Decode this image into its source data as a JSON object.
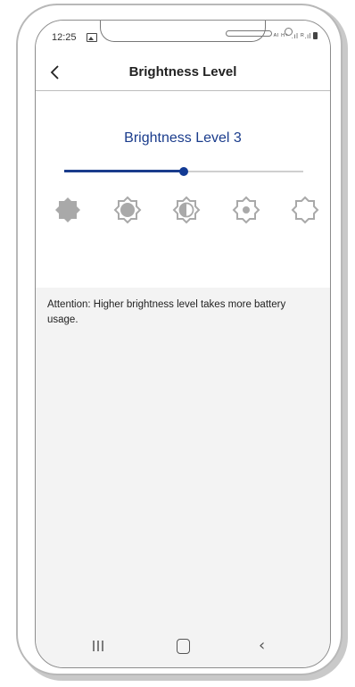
{
  "status_bar": {
    "time": "12:25",
    "indicators": "ᴬᴵ ᴴ⁺ .ıl ᴿ.ıl"
  },
  "header": {
    "back_icon": "chevron-left-icon",
    "title": "Brightness Level"
  },
  "brightness": {
    "label": "Brightness Level 3",
    "current_level": 3,
    "total_levels": 5,
    "active_color": "#1a3c8c",
    "inactive_color": "#cfcfcf",
    "icon_color": "#a9a9a9",
    "level_icons": [
      "sun-filled-icon",
      "sun-large-core-icon",
      "sun-half-icon",
      "sun-small-core-icon",
      "sun-outline-icon"
    ]
  },
  "attention": {
    "text": "Attention: Higher brightness level takes more battery usage."
  },
  "nav_bar": {
    "recents_icon": "recents-icon",
    "home_icon": "home-icon",
    "back_icon": "back-icon",
    "back_glyph": "‹"
  }
}
